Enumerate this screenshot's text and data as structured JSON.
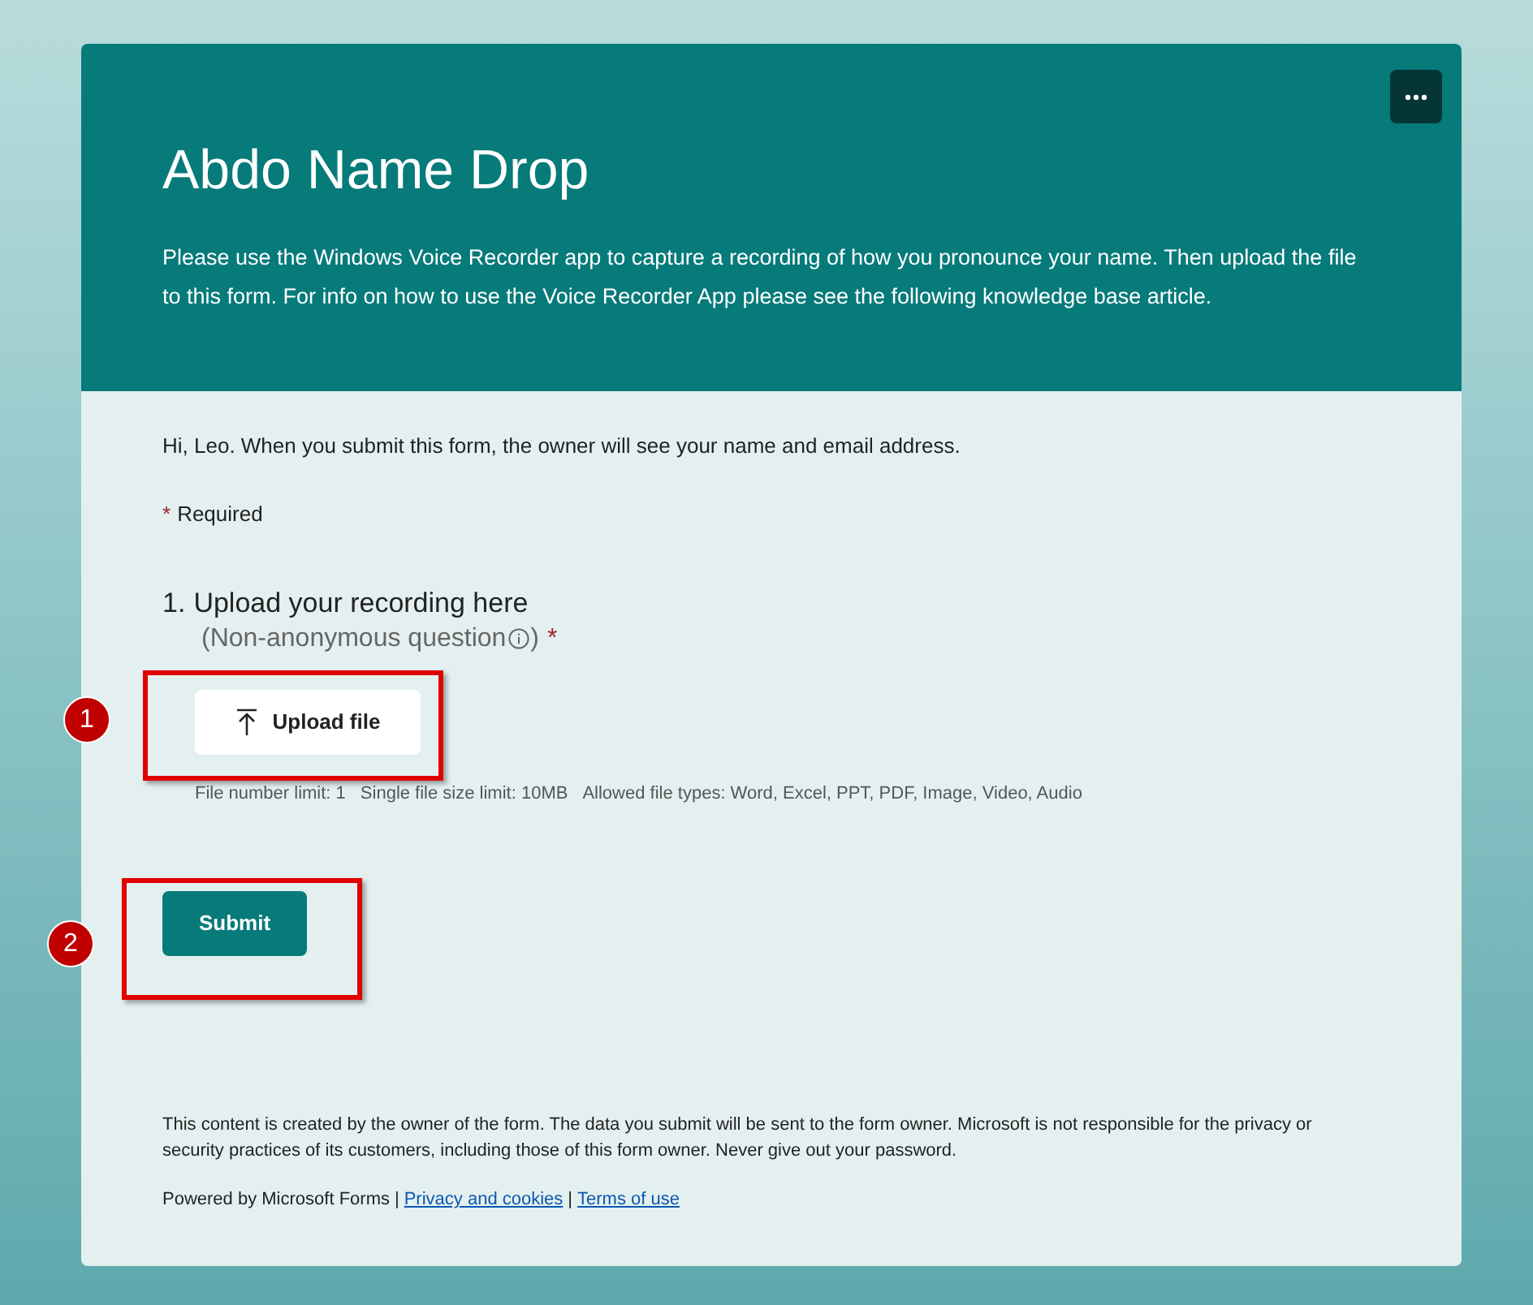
{
  "header": {
    "title": "Abdo Name Drop",
    "description": "Please use the Windows Voice Recorder app to capture a recording of how you pronounce your name. Then upload the file to this form. For info on how to use the Voice Recorder App please see the following knowledge base article."
  },
  "notice": "Hi, Leo. When you submit this form, the owner will see your name and email address.",
  "required_note": {
    "mark": "*",
    "label": "Required"
  },
  "question": {
    "number": "1.",
    "title": "Upload your recording here",
    "subtitle": "(Non-anonymous question",
    "subtitle_end": ")",
    "required_mark": "*",
    "upload_button": "Upload file",
    "limits": [
      "File number limit: 1",
      "Single file size limit: 10MB",
      "Allowed file types: Word, Excel, PPT, PDF, Image, Video, Audio"
    ]
  },
  "submit_button": "Submit",
  "footer": {
    "disclaimer": "This content is created by the owner of the form. The data you submit will be sent to the form owner. Microsoft is not responsible for the privacy or security practices of its customers, including those of this form owner. Never give out your password.",
    "powered_by": "Powered by Microsoft Forms",
    "separator_1": "|",
    "privacy_link": "Privacy and cookies",
    "separator_2": "|",
    "terms_link": "Terms of use"
  },
  "callouts": [
    {
      "number": "1"
    },
    {
      "number": "2"
    }
  ]
}
